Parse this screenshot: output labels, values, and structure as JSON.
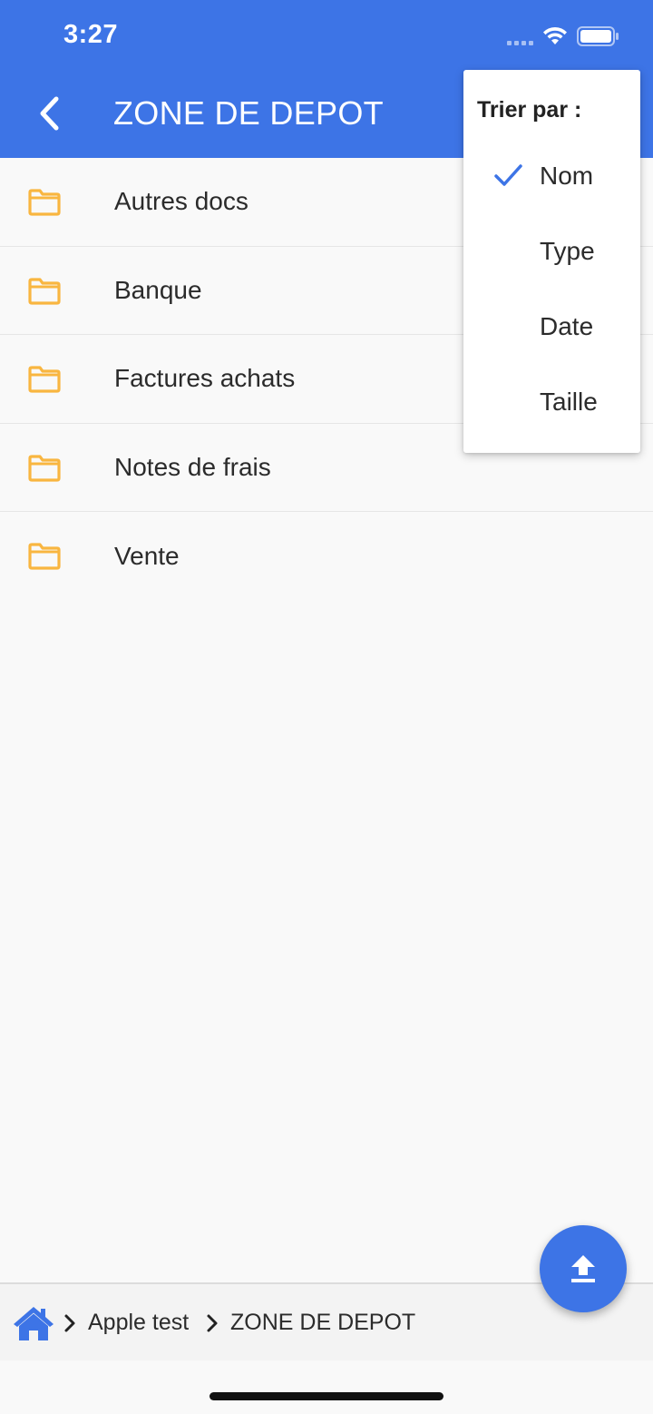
{
  "status_bar": {
    "time": "3:27"
  },
  "header": {
    "title": "ZONE DE DEPOT"
  },
  "folders": [
    {
      "label": "Autres docs"
    },
    {
      "label": "Banque"
    },
    {
      "label": "Factures achats"
    },
    {
      "label": "Notes de frais"
    },
    {
      "label": "Vente"
    }
  ],
  "sort_menu": {
    "title": "Trier par :",
    "options": [
      {
        "label": "Nom",
        "selected": true
      },
      {
        "label": "Type",
        "selected": false
      },
      {
        "label": "Date",
        "selected": false
      },
      {
        "label": "Taille",
        "selected": false
      }
    ]
  },
  "breadcrumb": {
    "items": [
      "Apple test",
      "ZONE DE DEPOT"
    ]
  },
  "colors": {
    "primary": "#3d74e6",
    "folder": "#f9b640",
    "background": "#f9f9f9"
  },
  "icons": {
    "back": "chevron-left-icon",
    "folder": "folder-icon",
    "check": "check-icon",
    "upload": "upload-icon",
    "home": "home-icon"
  }
}
